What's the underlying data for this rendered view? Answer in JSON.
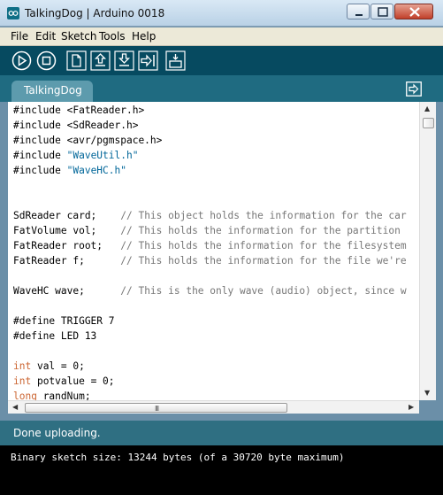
{
  "window": {
    "title": "TalkingDog | Arduino 0018"
  },
  "menu": [
    {
      "label": "File"
    },
    {
      "label": "Edit"
    },
    {
      "label": "Sketch"
    },
    {
      "label": "Tools"
    },
    {
      "label": "Help"
    }
  ],
  "toolbar": {
    "buttons": [
      {
        "icon": "play-icon",
        "name": "verify-button"
      },
      {
        "icon": "stop-icon",
        "name": "stop-button"
      },
      {
        "icon": "new-file-icon",
        "name": "new-button"
      },
      {
        "icon": "open-icon",
        "name": "open-button"
      },
      {
        "icon": "save-icon",
        "name": "save-button"
      },
      {
        "icon": "upload-icon",
        "name": "upload-button"
      },
      {
        "icon": "serial-monitor-icon",
        "name": "serial-monitor-button"
      }
    ]
  },
  "tabs": [
    {
      "label": "TalkingDog"
    }
  ],
  "editor": {
    "lines": [
      [
        {
          "t": "#include <FatReader.h>",
          "c": ""
        }
      ],
      [
        {
          "t": "#include <SdReader.h>",
          "c": ""
        }
      ],
      [
        {
          "t": "#include <avr/pgmspace.h>",
          "c": ""
        }
      ],
      [
        {
          "t": "#include ",
          "c": ""
        },
        {
          "t": "\"WaveUtil.h\"",
          "c": "str"
        }
      ],
      [
        {
          "t": "#include ",
          "c": ""
        },
        {
          "t": "\"WaveHC.h\"",
          "c": "str"
        }
      ],
      [],
      [],
      [
        {
          "t": "SdReader card;    ",
          "c": ""
        },
        {
          "t": "// This object holds the information for the car",
          "c": "cmt"
        }
      ],
      [
        {
          "t": "FatVolume vol;    ",
          "c": ""
        },
        {
          "t": "// This holds the information for the partition",
          "c": "cmt"
        }
      ],
      [
        {
          "t": "FatReader root;   ",
          "c": ""
        },
        {
          "t": "// This holds the information for the filesystem",
          "c": "cmt"
        }
      ],
      [
        {
          "t": "FatReader f;      ",
          "c": ""
        },
        {
          "t": "// This holds the information for the file we're",
          "c": "cmt"
        }
      ],
      [],
      [
        {
          "t": "WaveHC wave;      ",
          "c": ""
        },
        {
          "t": "// This is the only wave (audio) object, since w",
          "c": "cmt"
        }
      ],
      [],
      [
        {
          "t": "#define TRIGGER 7",
          "c": ""
        }
      ],
      [
        {
          "t": "#define LED 13",
          "c": ""
        }
      ],
      [],
      [
        {
          "t": "int",
          "c": "kw"
        },
        {
          "t": " val = 0;",
          "c": ""
        }
      ],
      [
        {
          "t": "int",
          "c": "kw"
        },
        {
          "t": " potvalue = 0;",
          "c": ""
        }
      ],
      [
        {
          "t": "long",
          "c": "kw"
        },
        {
          "t": " randNum;",
          "c": ""
        }
      ]
    ]
  },
  "status": {
    "text": "Done uploading."
  },
  "console": {
    "text": "Binary sketch size: 13244 bytes (of a 30720 byte maximum)"
  },
  "scrollbar": {
    "grip": "III"
  },
  "colors": {
    "toolbar_bg": "#064a60",
    "tabstrip_bg": "#1f6b81",
    "tab_bg": "#5d9bad",
    "status_bg": "#2f6f82",
    "keyword": "#cc6633",
    "string": "#006699",
    "comment": "#777777"
  }
}
